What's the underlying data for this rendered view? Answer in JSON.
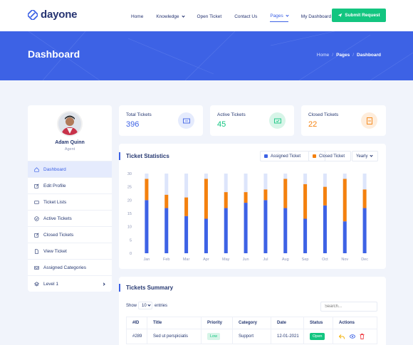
{
  "brand": {
    "name": "dayone"
  },
  "nav": {
    "items": [
      {
        "label": "Home",
        "dropdown": false,
        "active": false
      },
      {
        "label": "Knowledge",
        "dropdown": true,
        "active": false
      },
      {
        "label": "Open Ticket",
        "dropdown": false,
        "active": false
      },
      {
        "label": "Contact Us",
        "dropdown": false,
        "active": false
      },
      {
        "label": "Pages",
        "dropdown": true,
        "active": true
      },
      {
        "label": "My Dashboard",
        "dropdown": true,
        "active": false
      }
    ],
    "submit_label": "Submit Request"
  },
  "banner": {
    "title": "Dashboard",
    "breadcrumb": [
      "Home",
      "Pages",
      "Dashboard"
    ]
  },
  "profile": {
    "name": "Adam Quinn",
    "role": "Agent",
    "menu": [
      {
        "label": "Dashboard",
        "icon": "home-icon",
        "active": true
      },
      {
        "label": "Edit Profile",
        "icon": "edit-icon",
        "active": false
      },
      {
        "label": "Ticket Lists",
        "icon": "ticket-icon",
        "active": false
      },
      {
        "label": "Active Tickets",
        "icon": "check-circle-icon",
        "active": false
      },
      {
        "label": "Closed Tickets",
        "icon": "edit-icon",
        "active": false
      },
      {
        "label": "View Ticket",
        "icon": "file-icon",
        "active": false
      },
      {
        "label": "Assigned Categories",
        "icon": "inbox-icon",
        "active": false
      },
      {
        "label": "Level 1",
        "icon": "layers-icon",
        "active": false
      }
    ]
  },
  "stats": {
    "total": {
      "label": "Total Tickets",
      "value": "396",
      "color": "#3d62e5"
    },
    "active": {
      "label": "Active Tickets",
      "value": "45",
      "color": "#13c580"
    },
    "closed": {
      "label": "Closed Tickets",
      "value": "22",
      "color": "#f4810e"
    }
  },
  "statistics": {
    "title": "Ticket Statistics",
    "legend_assigned": "Assigned Ticket",
    "legend_closed": "Closed Ticket",
    "period": "Yearly"
  },
  "chart_data": {
    "type": "bar",
    "stacked": true,
    "categories": [
      "Jan",
      "Feb",
      "Mar",
      "Apr",
      "May",
      "Jun",
      "Jul",
      "Aug",
      "Sep",
      "Oct",
      "Nov",
      "Dec"
    ],
    "series": [
      {
        "name": "Assigned Ticket",
        "color": "#3d62e5",
        "values": [
          20,
          17,
          14,
          13,
          17,
          19,
          20,
          17,
          13,
          18,
          12,
          17
        ]
      },
      {
        "name": "Closed Ticket",
        "color": "#f4810e",
        "values": [
          8,
          5,
          7,
          15,
          6,
          4,
          4,
          11,
          13,
          7,
          16,
          7
        ]
      }
    ],
    "track_max": 30,
    "y_ticks": [
      0,
      5,
      10,
      15,
      20,
      25,
      30
    ],
    "ylim": [
      0,
      30
    ],
    "grid": false
  },
  "summary": {
    "title": "Tickets Summary",
    "show_label": "Show",
    "show_value": "10",
    "entries_label": "entries",
    "search_placeholder": "Search...",
    "headers": [
      "#ID",
      "Title",
      "Priority",
      "Category",
      "Date",
      "Status",
      "Actions"
    ],
    "rows": [
      {
        "id": "#289",
        "title": "Sed ut perspiciatis",
        "priority": "Low",
        "category": "Support",
        "date": "12-01-2021",
        "status": "Open"
      }
    ]
  },
  "colors": {
    "primary": "#3d62e5",
    "success": "#13c580",
    "warning": "#f4810e",
    "danger": "#f0474d"
  }
}
